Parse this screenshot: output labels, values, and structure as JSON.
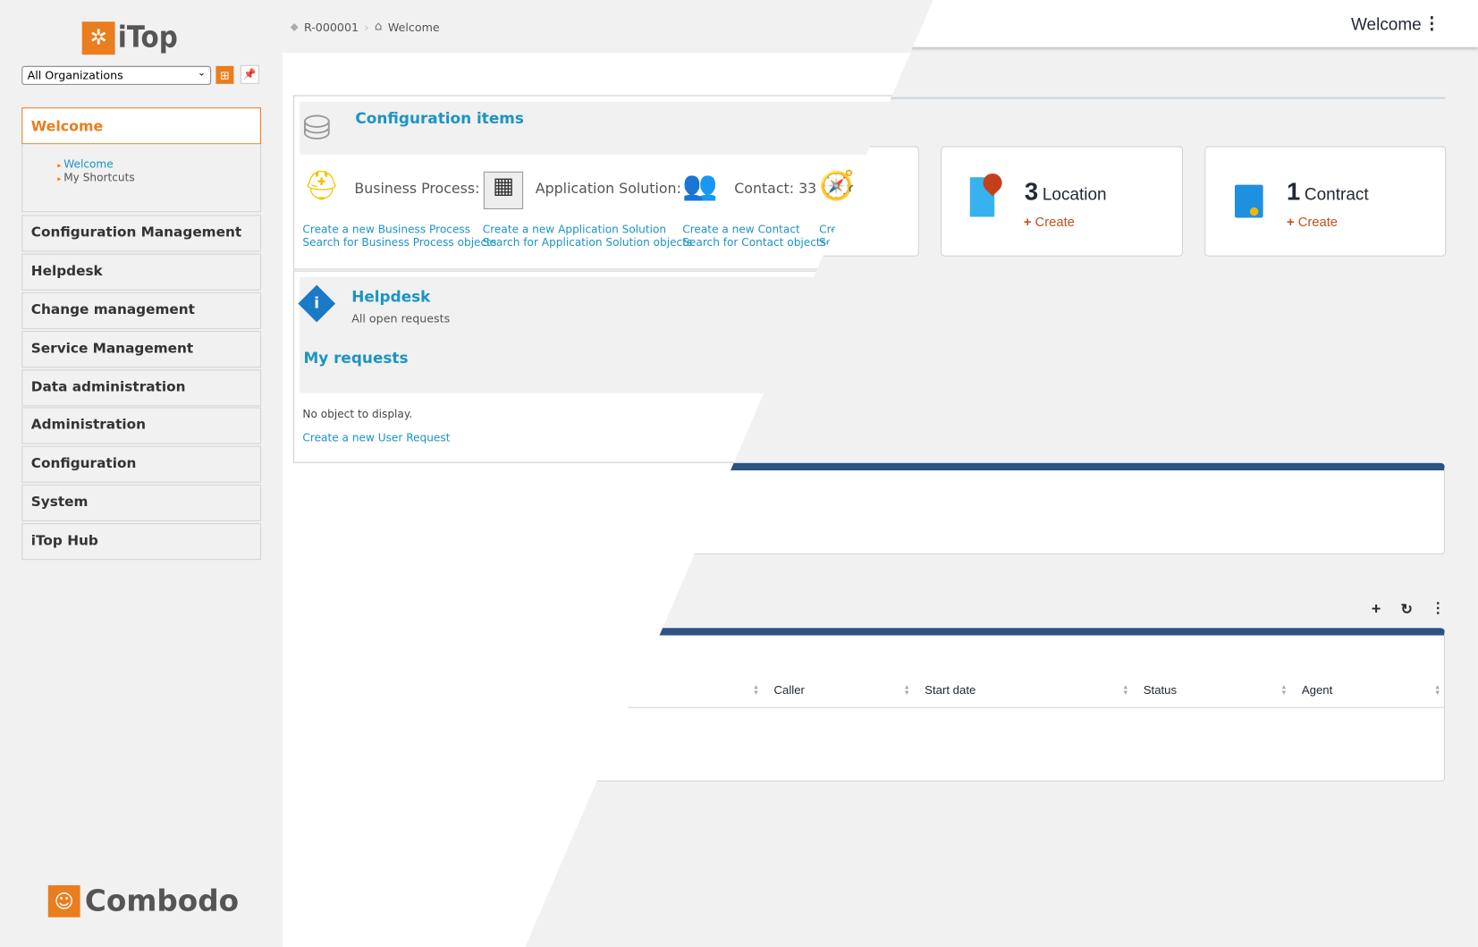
{
  "sidebar": {
    "logo_text": "iTop",
    "org_select": "All Organizations",
    "menu_groups": [
      {
        "label": "Welcome",
        "active": true,
        "items": [
          "Welcome",
          "My Shortcuts"
        ]
      },
      {
        "label": "Configuration Management"
      },
      {
        "label": "Helpdesk"
      },
      {
        "label": "Change management"
      },
      {
        "label": "Service Management"
      },
      {
        "label": "Data administration"
      },
      {
        "label": "Administration"
      },
      {
        "label": "Configuration"
      },
      {
        "label": "System"
      },
      {
        "label": "iTop Hub"
      }
    ],
    "footer_logo": "Combodo"
  },
  "breadcrumb": [
    "R-000001",
    "Welcome"
  ],
  "header": {
    "title": "Welcome"
  },
  "config_items": {
    "title": "Configuration items",
    "classes": [
      {
        "label": "Business Process: 0",
        "create": "Create a new Business Process",
        "search": "Search for Business Process objects"
      },
      {
        "label": "Application Solution: 4",
        "create": "Create a new Application Solution",
        "search": "Search for Application Solution objects"
      },
      {
        "label": "Contact: 33",
        "create": "Create a new Contact",
        "search": "Search for Contact objects"
      },
      {
        "label": "ct",
        "create": "Cre",
        "search": "Se"
      }
    ]
  },
  "helpdesk": {
    "title": "Helpdesk",
    "subtitle": "All open requests",
    "section": "My requests",
    "empty": "No object to display.",
    "create_link": "Create a new User Request"
  },
  "dashlets": [
    {
      "count": "3",
      "label": "Location",
      "create": "Create",
      "icon": "map-pin-icon"
    },
    {
      "count": "1",
      "label": "Contract",
      "create": "Create",
      "icon": "contract-icon"
    }
  ],
  "table": {
    "columns": [
      "Caller",
      "Start date",
      "Status",
      "Agent"
    ]
  },
  "colors": {
    "accent": "#ea7d1e",
    "link": "#1c94c4",
    "panel_top": "#2c5382",
    "create": "#c4501c"
  }
}
